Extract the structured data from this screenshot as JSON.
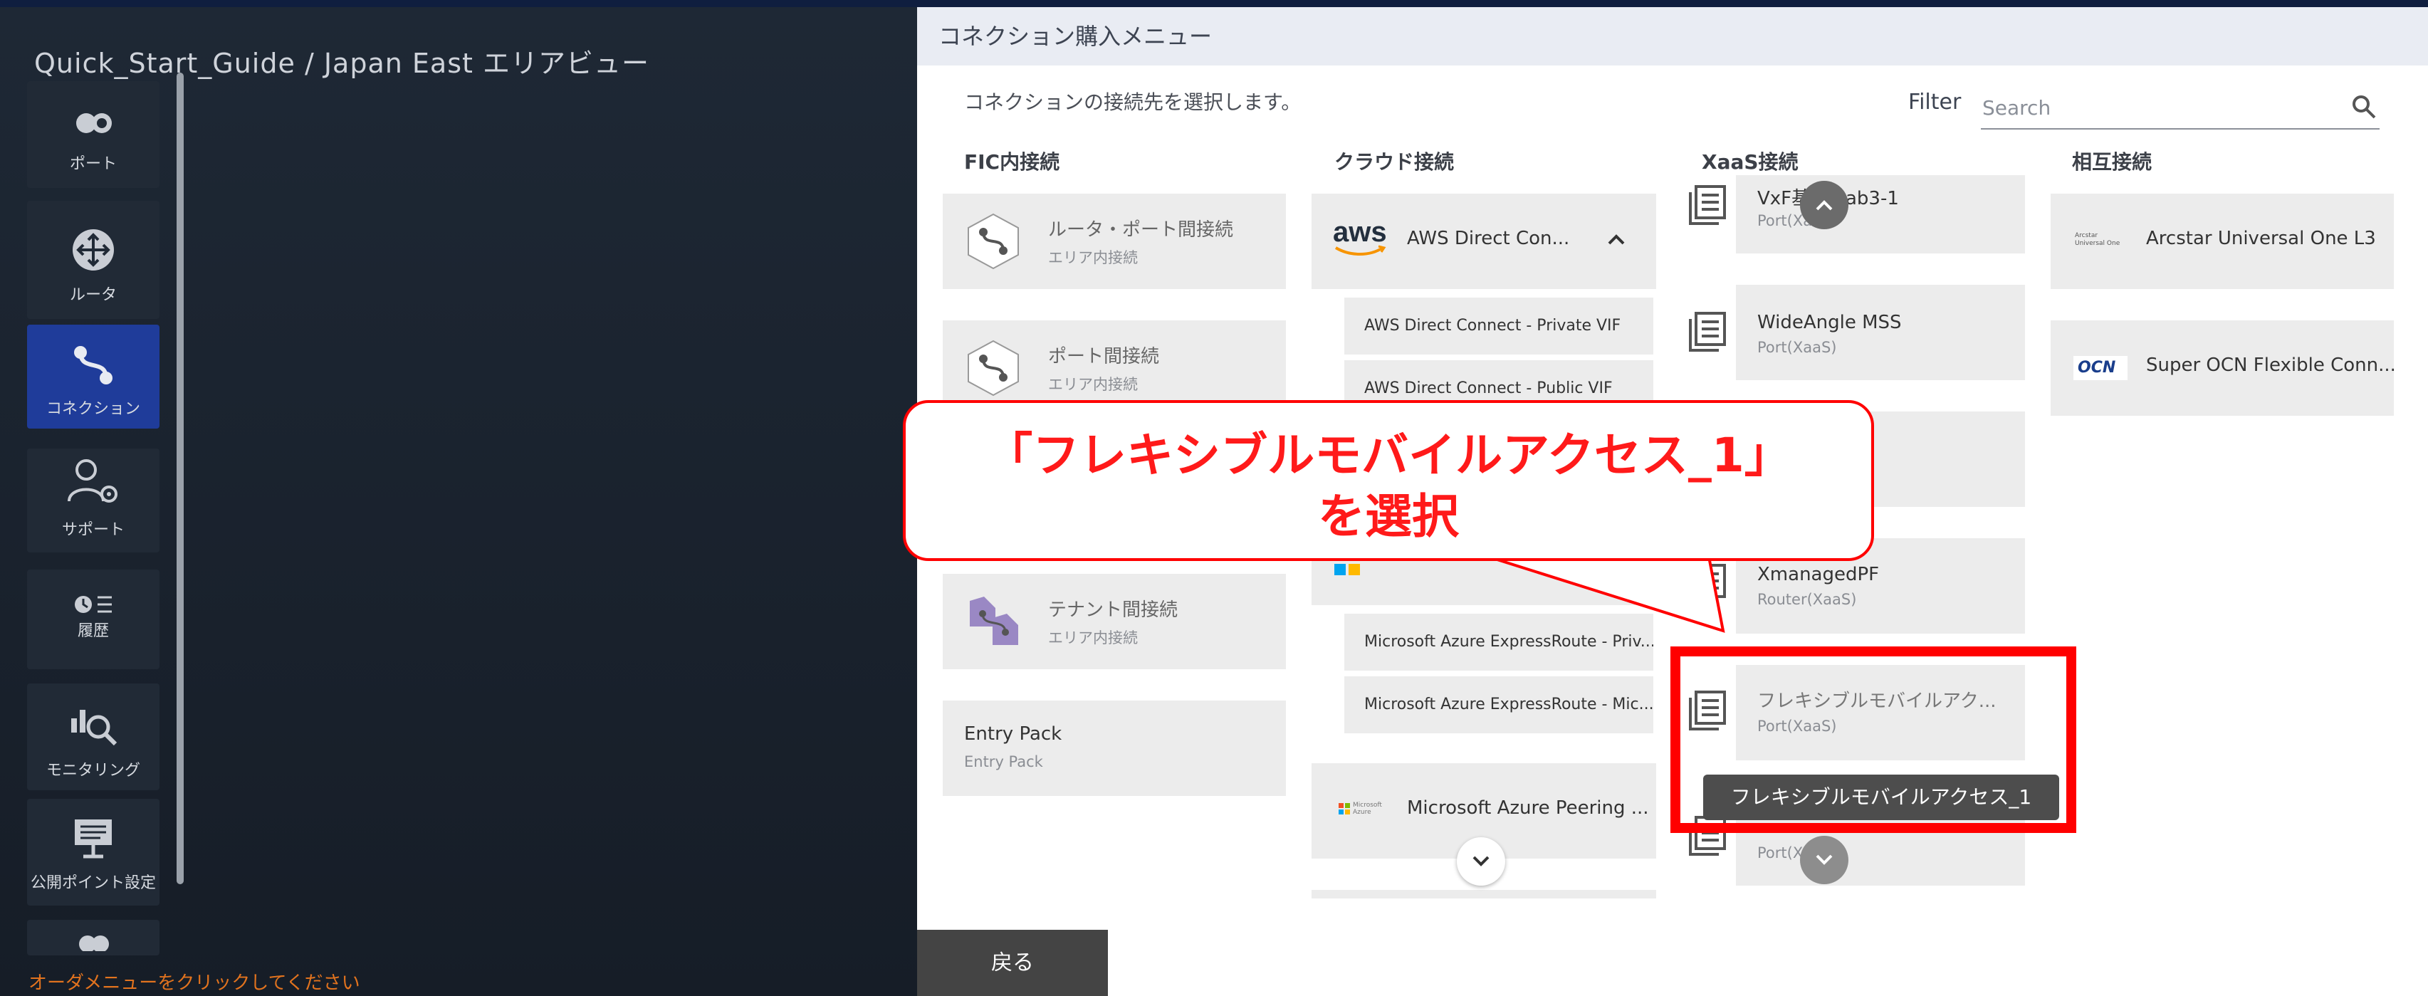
{
  "area_title": "Quick_Start_Guide / Japan East エリアビュー",
  "nav": [
    {
      "label": "ポート",
      "icon": "port-icon"
    },
    {
      "label": "ルータ",
      "icon": "router-icon"
    },
    {
      "label": "コネクション",
      "icon": "connection-icon",
      "active": true
    },
    {
      "label": "サポート",
      "icon": "support-icon"
    },
    {
      "label": "履歴",
      "icon": "history-icon"
    },
    {
      "label": "モニタリング",
      "icon": "monitoring-icon"
    },
    {
      "label": "公開ポイント設定",
      "icon": "public-point-icon"
    }
  ],
  "footer_hint": "オーダメニューをクリックしてください",
  "panel": {
    "title": "コネクション購入メニュー",
    "subtitle": "コネクションの接続先を選択します。",
    "filter_label": "Filter",
    "search_placeholder": "Search"
  },
  "columns": {
    "fic": "FIC内接続",
    "cloud": "クラウド接続",
    "xaas": "XaaS接続",
    "mutual": "相互接続"
  },
  "fic_cards": [
    {
      "title": "ルータ・ポート間接続",
      "sub": "エリア内接続"
    },
    {
      "title": "ポート間接続",
      "sub": "エリア内接続"
    },
    {
      "title": "テナント間接続",
      "sub": "エリア内接続"
    },
    {
      "title": "Entry Pack",
      "sub": "Entry Pack"
    }
  ],
  "cloud": {
    "aws_logo": "aws",
    "aws_title": "AWS Direct Con...",
    "aws_sub": [
      "AWS Direct Connect - Private VIF",
      "AWS Direct Connect - Public VIF"
    ],
    "azure_sub": [
      "Microsoft Azure ExpressRoute - Priv...",
      "Microsoft Azure ExpressRoute - Mic..."
    ],
    "azure_peering_title": "Microsoft Azure Peering ...",
    "azure_logo_text": "Microsoft Azure"
  },
  "xaas_cards": [
    {
      "title": "VxF基盤-Lab3-1",
      "sub": "Port(XaaS)"
    },
    {
      "title": "WideAngle MSS",
      "sub": "Port(XaaS)"
    },
    {
      "title": "",
      "sub": ""
    },
    {
      "title": "XmanagedPF",
      "sub": "Router(XaaS)"
    },
    {
      "title": "フレキシブルモバイルアク...",
      "sub": "Port(XaaS)"
    },
    {
      "title": "",
      "sub": "Port(XaaS)"
    }
  ],
  "mutual_cards": [
    {
      "title": "Arcstar Universal One L3",
      "logo": "Arcstar Universal One"
    },
    {
      "title": "Super OCN Flexible Conn...",
      "logo": "OCN"
    }
  ],
  "tooltip": "フレキシブルモバイルアクセス_1",
  "callout": {
    "line1": "「フレキシブルモバイルアクセス_1」",
    "line2": "を選択"
  },
  "back_label": "戻る"
}
